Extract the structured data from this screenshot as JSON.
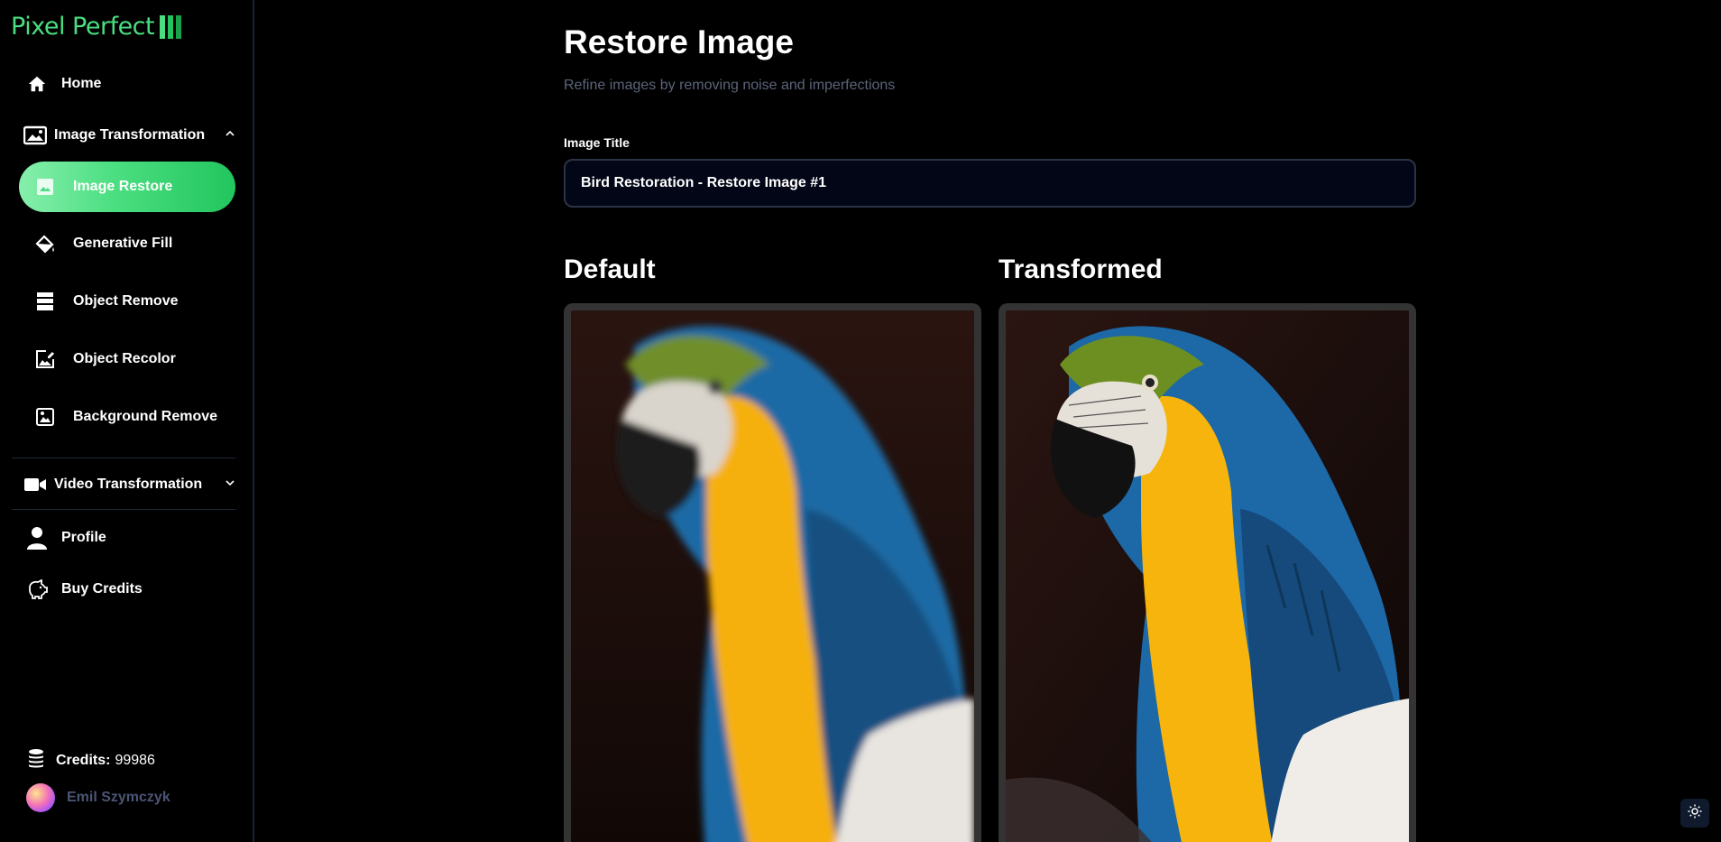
{
  "app": {
    "logo_text": "Pixel Perfect",
    "accent_color": "#4ade80"
  },
  "sidebar": {
    "home_label": "Home",
    "image_section": {
      "label": "Image Transformation",
      "items": [
        {
          "label": "Image Restore",
          "icon": "image-icon",
          "active": true
        },
        {
          "label": "Generative Fill",
          "icon": "paint-bucket-icon",
          "active": false
        },
        {
          "label": "Object Remove",
          "icon": "layers-icon",
          "active": false
        },
        {
          "label": "Object Recolor",
          "icon": "image-edit-icon",
          "active": false
        },
        {
          "label": "Background Remove",
          "icon": "image-frame-icon",
          "active": false
        }
      ]
    },
    "video_section": {
      "label": "Video Transformation"
    },
    "profile_label": "Profile",
    "buy_credits_label": "Buy Credits",
    "credits_label": "Credits:",
    "credits_value": "99986",
    "user_name": "Emil Szymczyk"
  },
  "main": {
    "title": "Restore Image",
    "subtitle": "Refine images by removing noise and imperfections",
    "field_label": "Image Title",
    "field_value": "Bird Restoration - Restore Image #1",
    "default_title": "Default",
    "transformed_title": "Transformed"
  }
}
